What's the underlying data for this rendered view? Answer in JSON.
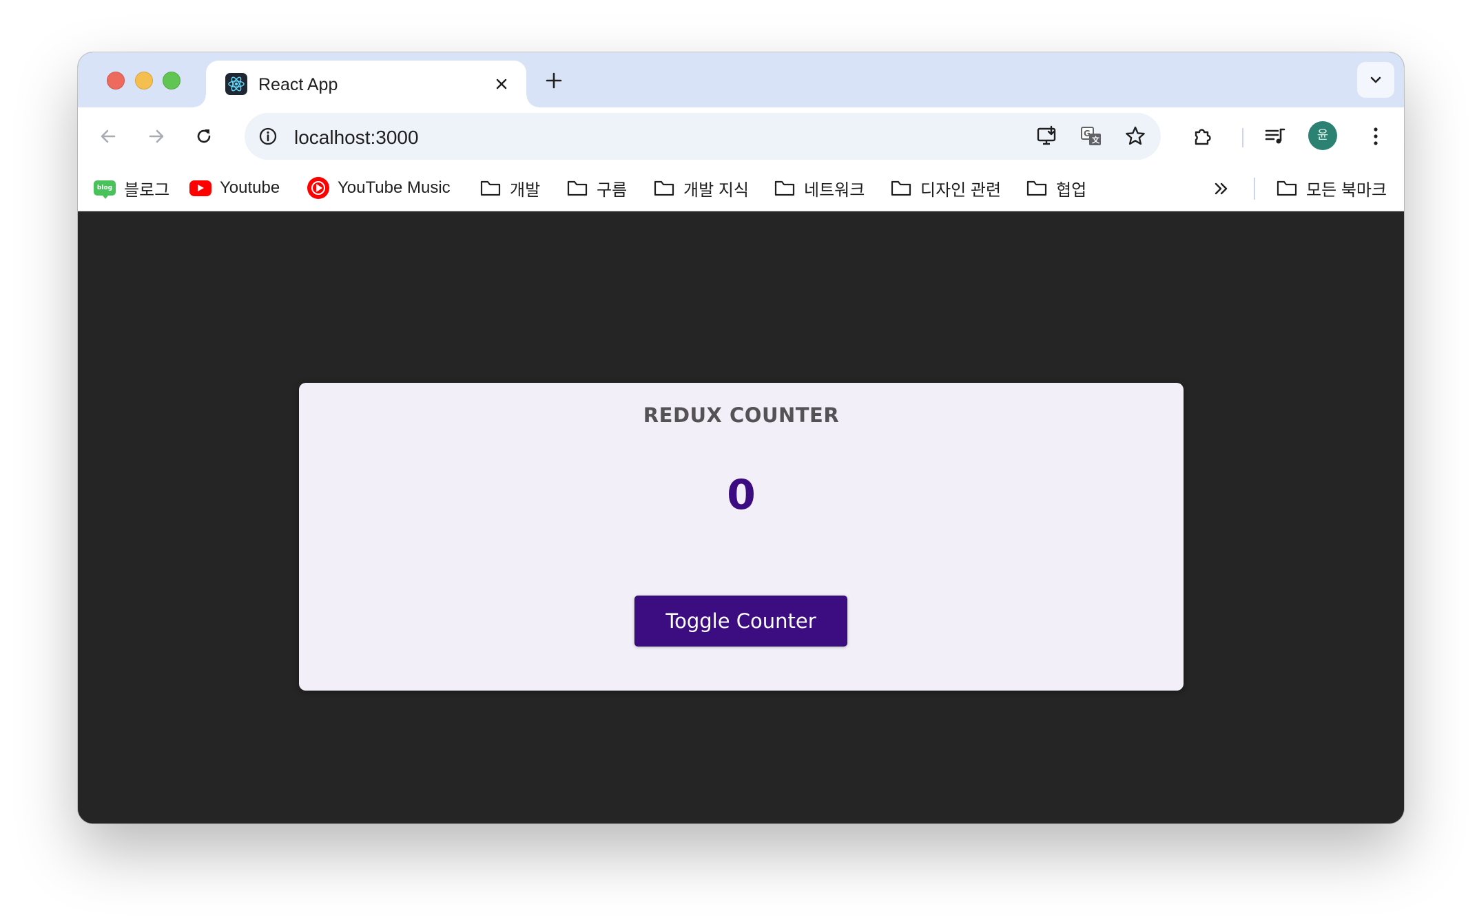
{
  "browser": {
    "tab": {
      "title": "React App",
      "favicon": "react-icon"
    },
    "omnibox": {
      "url": "localhost:3000"
    },
    "avatar_initial": "윤",
    "bookmarks": [
      {
        "label": "블로그",
        "icon": "blog-icon"
      },
      {
        "label": "Youtube",
        "icon": "youtube-icon"
      },
      {
        "label": "YouTube Music",
        "icon": "youtube-music-icon"
      },
      {
        "label": "개발",
        "icon": "folder-icon"
      },
      {
        "label": "구름",
        "icon": "folder-icon"
      },
      {
        "label": "개발 지식",
        "icon": "folder-icon"
      },
      {
        "label": "네트워크",
        "icon": "folder-icon"
      },
      {
        "label": "디자인 관련",
        "icon": "folder-icon"
      },
      {
        "label": "협업",
        "icon": "folder-icon"
      }
    ],
    "all_bookmarks_label": "모든 북마크"
  },
  "app": {
    "title": "REDUX COUNTER",
    "counter_value": "0",
    "toggle_label": "Toggle Counter"
  },
  "colors": {
    "accent": "#3c0d80",
    "card_background": "#f2eff8",
    "page_background": "#252525",
    "tab_strip": "#d8e3f8"
  }
}
